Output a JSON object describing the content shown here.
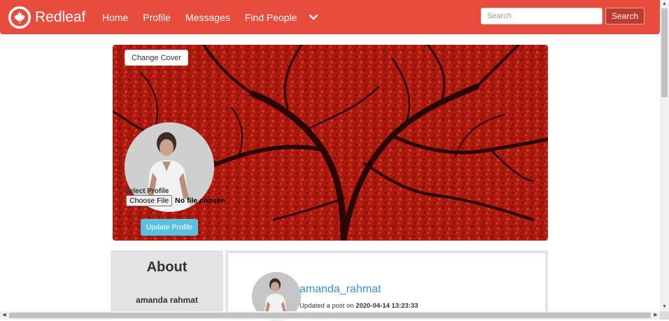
{
  "navbar": {
    "brand": "Redleaf",
    "links": [
      "Home",
      "Profile",
      "Messages",
      "Find People"
    ],
    "search_placeholder": "Search",
    "search_button": "Search",
    "bg_color": "#e74c3c"
  },
  "cover": {
    "change_cover_label": "Change Cover",
    "select_profile_label": "Select Profile",
    "choose_file_label": "Choose File",
    "no_file_text": "No file chosen",
    "update_profile_label": "Update Profile"
  },
  "about": {
    "title": "About",
    "name": "amanda rahmat"
  },
  "post": {
    "username": "amanda_rahmat",
    "meta_prefix": "Updated a post on ",
    "timestamp": "2020-04-14 13:23:33"
  }
}
